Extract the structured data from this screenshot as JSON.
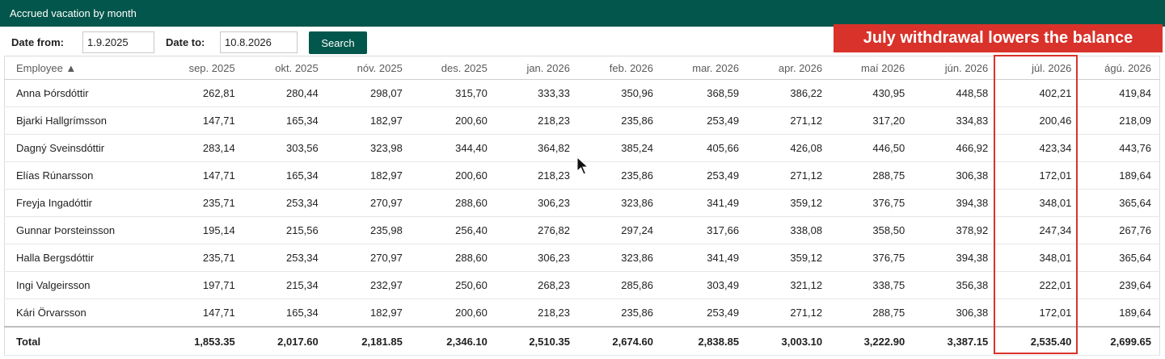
{
  "window": {
    "title": "Accrued vacation by month"
  },
  "filters": {
    "date_from_label": "Date from:",
    "date_from_value": "1.9.2025",
    "date_to_label": "Date to:",
    "date_to_value": "10.8.2026",
    "search_label": "Search"
  },
  "annotation": {
    "text": "July withdrawal lowers the balance",
    "color": "#d9322a",
    "highlighted_column": "júl. 2026"
  },
  "colors": {
    "header_green": "#03564b",
    "callout_red": "#d9322a"
  },
  "table": {
    "employee_header": "Employee ▲",
    "sort": {
      "column": "Employee",
      "direction": "ascending",
      "icon": "sort-ascending-icon"
    },
    "months": [
      "sep. 2025",
      "okt. 2025",
      "nóv. 2025",
      "des. 2025",
      "jan. 2026",
      "feb. 2026",
      "mar. 2026",
      "apr. 2026",
      "maí 2026",
      "jún. 2026",
      "júl. 2026",
      "ágú. 2026"
    ],
    "rows": [
      {
        "name": "Anna Þórsdóttir",
        "values": [
          "262,81",
          "280,44",
          "298,07",
          "315,70",
          "333,33",
          "350,96",
          "368,59",
          "386,22",
          "430,95",
          "448,58",
          "402,21",
          "419,84"
        ]
      },
      {
        "name": "Bjarki Hallgrímsson",
        "values": [
          "147,71",
          "165,34",
          "182,97",
          "200,60",
          "218,23",
          "235,86",
          "253,49",
          "271,12",
          "317,20",
          "334,83",
          "200,46",
          "218,09"
        ]
      },
      {
        "name": "Dagný Sveinsdóttir",
        "values": [
          "283,14",
          "303,56",
          "323,98",
          "344,40",
          "364,82",
          "385,24",
          "405,66",
          "426,08",
          "446,50",
          "466,92",
          "423,34",
          "443,76"
        ]
      },
      {
        "name": "Elías Rúnarsson",
        "values": [
          "147,71",
          "165,34",
          "182,97",
          "200,60",
          "218,23",
          "235,86",
          "253,49",
          "271,12",
          "288,75",
          "306,38",
          "172,01",
          "189,64"
        ]
      },
      {
        "name": "Freyja Ingadóttir",
        "values": [
          "235,71",
          "253,34",
          "270,97",
          "288,60",
          "306,23",
          "323,86",
          "341,49",
          "359,12",
          "376,75",
          "394,38",
          "348,01",
          "365,64"
        ]
      },
      {
        "name": "Gunnar Þorsteinsson",
        "values": [
          "195,14",
          "215,56",
          "235,98",
          "256,40",
          "276,82",
          "297,24",
          "317,66",
          "338,08",
          "358,50",
          "378,92",
          "247,34",
          "267,76"
        ]
      },
      {
        "name": "Halla Bergsdóttir",
        "values": [
          "235,71",
          "253,34",
          "270,97",
          "288,60",
          "306,23",
          "323,86",
          "341,49",
          "359,12",
          "376,75",
          "394,38",
          "348,01",
          "365,64"
        ]
      },
      {
        "name": "Ingi Valgeirsson",
        "values": [
          "197,71",
          "215,34",
          "232,97",
          "250,60",
          "268,23",
          "285,86",
          "303,49",
          "321,12",
          "338,75",
          "356,38",
          "222,01",
          "239,64"
        ]
      },
      {
        "name": "Kári Örvarsson",
        "values": [
          "147,71",
          "165,34",
          "182,97",
          "200,60",
          "218,23",
          "235,86",
          "253,49",
          "271,12",
          "288,75",
          "306,38",
          "172,01",
          "189,64"
        ]
      }
    ],
    "total": {
      "label": "Total",
      "values": [
        "1,853.35",
        "2,017.60",
        "2,181.85",
        "2,346.10",
        "2,510.35",
        "2,674.60",
        "2,838.85",
        "3,003.10",
        "3,222.90",
        "3,387.15",
        "2,535.40",
        "2,699.65"
      ]
    }
  }
}
